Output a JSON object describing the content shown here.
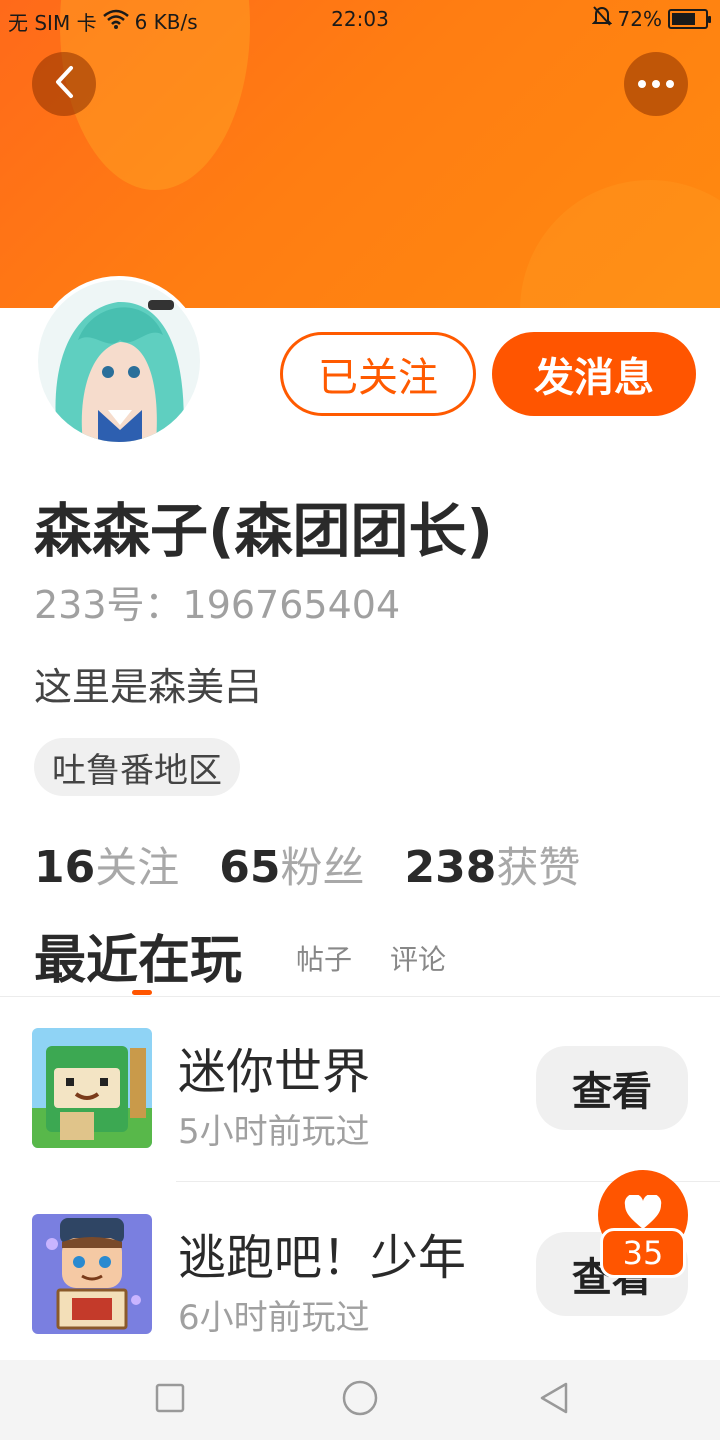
{
  "status_bar": {
    "carrier": "无 SIM 卡",
    "speed": "6 KB/s",
    "time": "22:03",
    "battery_text": "72%",
    "battery_level": 0.72
  },
  "header": {
    "back_icon": "chevron-left-icon",
    "more_icon": "more-dots-icon",
    "accent_color": "#ff5500"
  },
  "profile": {
    "followed_label": "已关注",
    "message_label": "发消息",
    "username": "森森子(森团团长)",
    "id_text": "233号：196765404",
    "bio": "这里是森美吕",
    "region": "吐鲁番地区",
    "stats": [
      {
        "value": "16",
        "label": "关注"
      },
      {
        "value": "65",
        "label": "粉丝"
      },
      {
        "value": "238",
        "label": "获赞"
      }
    ]
  },
  "tabs": {
    "active": "最近在玩",
    "posts": "帖子",
    "comments": "评论"
  },
  "games": [
    {
      "name": "迷你世界",
      "time": "5小时前玩过",
      "button": "查看"
    },
    {
      "name": "逃跑吧！少年",
      "time": "6小时前玩过",
      "button": "查看"
    }
  ],
  "like_fab": {
    "count": "35",
    "icon": "heart-icon"
  },
  "nav_bar": {
    "recent_icon": "square-icon",
    "home_icon": "circle-icon",
    "back_icon": "triangle-back-icon"
  }
}
